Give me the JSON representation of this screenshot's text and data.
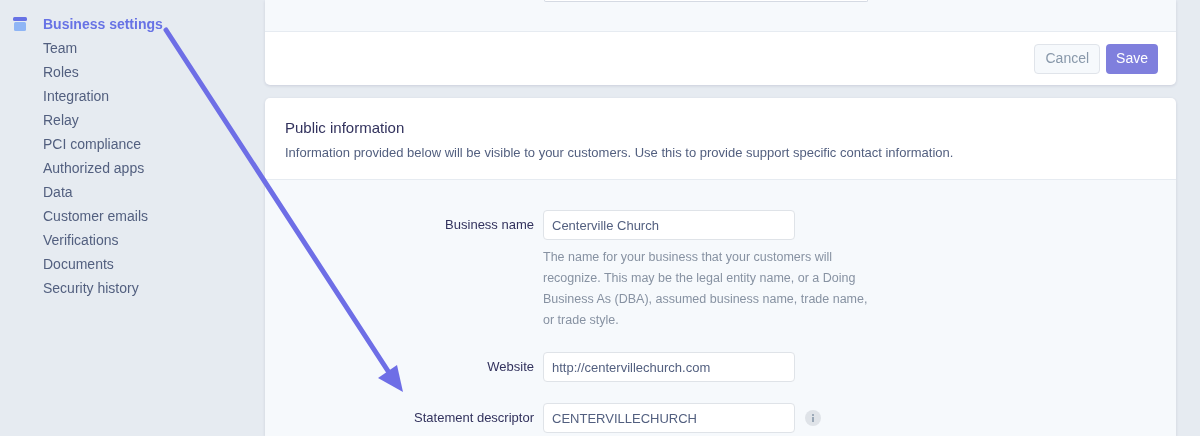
{
  "sidebar": {
    "items": [
      {
        "label": "Business settings",
        "selected": true,
        "kind": "header"
      },
      {
        "label": "Team",
        "selected": false,
        "kind": "sub"
      },
      {
        "label": "Roles",
        "selected": false,
        "kind": "sub"
      },
      {
        "label": "Integration",
        "selected": false,
        "kind": "sub"
      },
      {
        "label": "Relay",
        "selected": false,
        "kind": "sub"
      },
      {
        "label": "PCI compliance",
        "selected": false,
        "kind": "sub"
      },
      {
        "label": "Authorized apps",
        "selected": false,
        "kind": "sub"
      },
      {
        "label": "Data",
        "selected": false,
        "kind": "sub"
      },
      {
        "label": "Customer emails",
        "selected": false,
        "kind": "sub"
      },
      {
        "label": "Verifications",
        "selected": false,
        "kind": "sub"
      },
      {
        "label": "Documents",
        "selected": false,
        "kind": "sub"
      },
      {
        "label": "Security history",
        "selected": false,
        "kind": "sub"
      }
    ]
  },
  "top_card": {
    "buttons": [
      {
        "label": "Cancel",
        "kind": "secondary"
      },
      {
        "label": "Save",
        "kind": "primary"
      }
    ]
  },
  "public_information": {
    "title": "Public information",
    "description": "Information provided below will be visible to your customers. Use this to provide support specific contact information.",
    "fields": [
      {
        "label": "Business name",
        "value": "Centerville Church",
        "help": "The name for your business that your customers will recognize. This may be the legal entity name, or a Doing Business As (DBA), assumed business name, trade name, or trade style.",
        "info": false
      },
      {
        "label": "Website",
        "value": "http://centervillechurch.com",
        "info": false
      },
      {
        "label": "Statement descriptor",
        "value": "CENTERVILLECHURCH",
        "info": true
      }
    ]
  }
}
